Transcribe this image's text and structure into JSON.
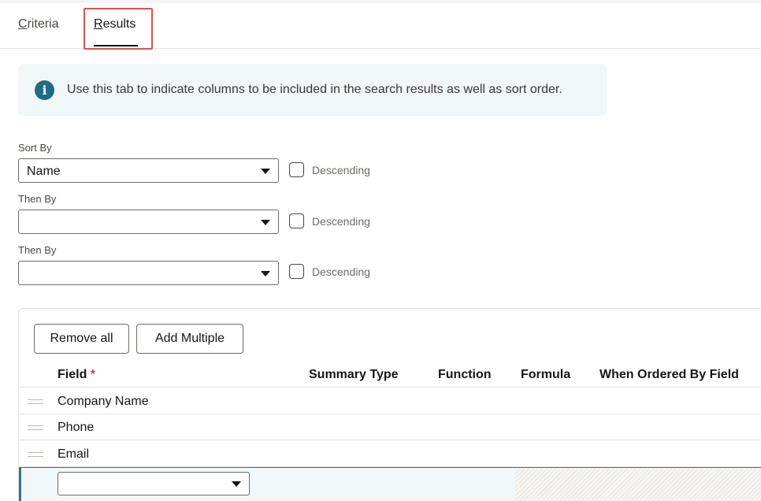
{
  "tabs": [
    {
      "label": "Criteria",
      "accel": "C",
      "rest": "riteria"
    },
    {
      "label": "Results",
      "accel": "R",
      "rest": "esults",
      "active": true
    }
  ],
  "info": {
    "icon": "info-icon",
    "text": "Use this tab to indicate columns to be included in the search results as well as sort order."
  },
  "sort": {
    "sort_by_label": "Sort By",
    "sort_by_value": "Name",
    "then_by_label": "Then By",
    "then_by_1_value": "",
    "then_by_2_value": "",
    "descending_label": "Descending"
  },
  "results": {
    "remove_all_label": "Remove all",
    "add_multiple_label": "Add Multiple",
    "columns": {
      "field": "Field",
      "required_mark": "*",
      "summary_type": "Summary Type",
      "function": "Function",
      "formula": "Formula",
      "when_ordered_by": "When Ordered By Field"
    },
    "rows": [
      "Company Name",
      "Phone",
      "Email"
    ],
    "new_row_value": ""
  },
  "colors": {
    "accent": "#1f6c86",
    "required": "#c74634",
    "highlight": "#d9534f"
  }
}
